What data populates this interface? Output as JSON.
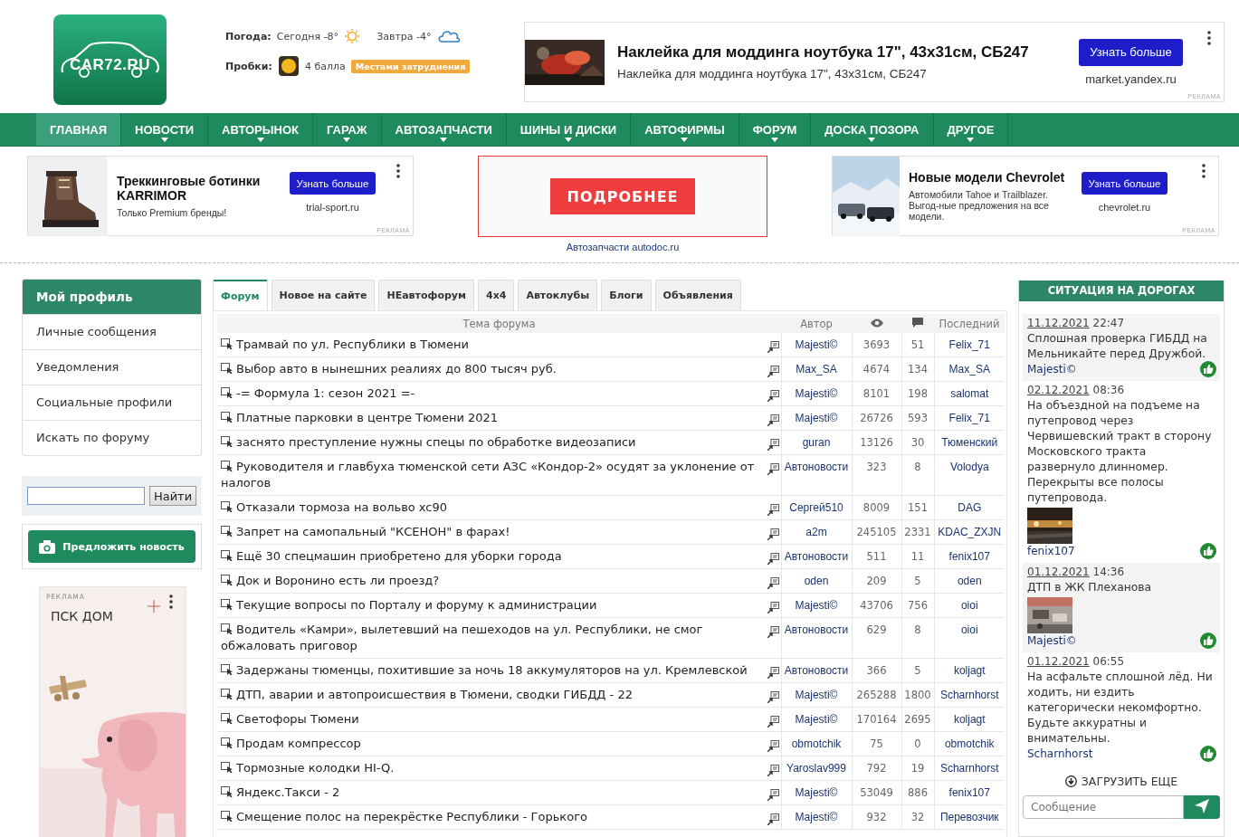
{
  "logo": {
    "text": "CAR72.RU"
  },
  "weather": {
    "label": "Погода:",
    "today": "Сегодня -8°",
    "tomorrow": "Завтра -4°"
  },
  "traffic": {
    "label": "Пробки:",
    "score": "4 балла",
    "status": "Местами затруднения"
  },
  "header_ad": {
    "title": "Наклейка для моддинга ноутбука 17\", 43x31см, СБ247",
    "text": "Наклейка для моддинга ноутбука 17\", 43x31см, СБ247",
    "button": "Узнать больше",
    "domain": "market.yandex.ru",
    "label": "РЕКЛАМА"
  },
  "nav": [
    {
      "label": "ГЛАВНАЯ",
      "selected": true,
      "has_menu": false
    },
    {
      "label": "НОВОСТИ",
      "selected": false,
      "has_menu": true
    },
    {
      "label": "АВТОРЫНОК",
      "selected": false,
      "has_menu": true
    },
    {
      "label": "ГАРАЖ",
      "selected": false,
      "has_menu": true
    },
    {
      "label": "АВТОЗАПЧАСТИ",
      "selected": false,
      "has_menu": true
    },
    {
      "label": "ШИНЫ И ДИСКИ",
      "selected": false,
      "has_menu": true
    },
    {
      "label": "АВТОФИРМЫ",
      "selected": false,
      "has_menu": true
    },
    {
      "label": "ФОРУМ",
      "selected": false,
      "has_menu": true
    },
    {
      "label": "ДОСКА ПОЗОРА",
      "selected": false,
      "has_menu": true
    },
    {
      "label": "ДРУГОЕ",
      "selected": false,
      "has_menu": true
    }
  ],
  "ads": [
    {
      "kind": "product",
      "title": "Треккинговые ботинки KARRIMOR",
      "text": "Только Premium бренды!",
      "button": "Узнать больше",
      "domain": "trial-sport.ru",
      "label": "РЕКЛАМА"
    },
    {
      "kind": "banner",
      "button": "ПОДРОБНЕЕ",
      "caption": "Автозапчасти autodoc.ru"
    },
    {
      "kind": "product",
      "title": "Новые модели Chevrolet",
      "text": "Автомобили Tahoe и Trailblazer. Выгод-ные предложения на все модели.",
      "button": "Узнать больше",
      "domain": "chevrolet.ru",
      "label": "РЕКЛАМА"
    }
  ],
  "profile": {
    "title": "Мой профиль",
    "items": [
      "Личные сообщения",
      "Уведомления",
      "Социальные профили",
      "Искать по форуму"
    ]
  },
  "search": {
    "button": "Найти"
  },
  "suggest_button": "Предложить новость",
  "side_ad": {
    "label": "РЕКЛАМА",
    "brand": "ПСК ДОМ"
  },
  "tabs": [
    {
      "label": "Форум",
      "selected": true
    },
    {
      "label": "Новое на сайте",
      "selected": false
    },
    {
      "label": "НЕавтофорум",
      "selected": false
    },
    {
      "label": "4x4",
      "selected": false
    },
    {
      "label": "Автоклубы",
      "selected": false
    },
    {
      "label": "Блоги",
      "selected": false
    },
    {
      "label": "Объявления",
      "selected": false
    }
  ],
  "forum": {
    "columns": [
      {
        "kind": "text",
        "label": "Тема форума"
      },
      {
        "kind": "text",
        "label": "Автор"
      },
      {
        "kind": "views"
      },
      {
        "kind": "replies"
      },
      {
        "kind": "text",
        "label": "Последний"
      }
    ],
    "rows": [
      {
        "title": "Трамвай по ул. Республики в Тюмени",
        "author": "Majesti©",
        "views": "3693",
        "replies": "51",
        "last": "Felix_71"
      },
      {
        "title": "Выбор авто в нынешних реалиях до 800 тысяч руб.",
        "author": "Max_SA",
        "views": "4674",
        "replies": "134",
        "last": "Max_SA"
      },
      {
        "title": "-= Формула 1: сезон 2021 =-",
        "author": "Majesti©",
        "views": "8101",
        "replies": "198",
        "last": "salomat"
      },
      {
        "title": "Платные парковки в центре Тюмени 2021",
        "author": "Majesti©",
        "views": "26726",
        "replies": "593",
        "last": "Felix_71"
      },
      {
        "title": "заснято преступление нужны спецы по обработке видеозаписи",
        "author": "guran",
        "views": "13126",
        "replies": "30",
        "last": "Тюменский"
      },
      {
        "title": "Руководителя и главбуха тюменской сети АЗС «Кондор-2» осудят за уклонение от налогов",
        "author": "Автоновости",
        "views": "323",
        "replies": "8",
        "last": "Volodya"
      },
      {
        "title": "Отказали тормоза на вольво xc90",
        "author": "Сергей510",
        "views": "8009",
        "replies": "151",
        "last": "DAG"
      },
      {
        "title": "Запрет на самопальный \"КСЕНОН\" в фарах!",
        "author": "a2m",
        "views": "245105",
        "replies": "2331",
        "last": "KDAC_ZXJN"
      },
      {
        "title": "Ещё 30 спецмашин приобретено для уборки города",
        "author": "Автоновости",
        "views": "511",
        "replies": "11",
        "last": "fenix107"
      },
      {
        "title": "Док и Воронино есть ли проезд?",
        "author": "oden",
        "views": "209",
        "replies": "5",
        "last": "oden"
      },
      {
        "title": "Текущие вопросы по Порталу и форуму к администрации",
        "author": "Majesti©",
        "views": "43706",
        "replies": "756",
        "last": "oioi"
      },
      {
        "title": "Водитель «Камри», вылетевший на пешеходов на ул. Республики, не смог обжаловать приговор",
        "author": "Автоновости",
        "views": "629",
        "replies": "8",
        "last": "oioi"
      },
      {
        "title": "Задержаны тюменцы, похитившие за ночь 18 аккумуляторов на ул. Кремлевской",
        "author": "Автоновости",
        "views": "366",
        "replies": "5",
        "last": "koljagt"
      },
      {
        "title": "ДТП, аварии и автопроисшествия в Тюмени, сводки ГИБДД - 22",
        "author": "Majesti©",
        "views": "265288",
        "replies": "1800",
        "last": "Scharnhorst"
      },
      {
        "title": "Светофоры Тюмени",
        "author": "Majesti©",
        "views": "170164",
        "replies": "2695",
        "last": "koljagt"
      },
      {
        "title": "Продам компрессор",
        "author": "obmotchik",
        "views": "75",
        "replies": "0",
        "last": "obmotchik"
      },
      {
        "title": "Тормозные колодки HI-Q.",
        "author": "Yaroslav999",
        "views": "792",
        "replies": "19",
        "last": "Scharnhorst"
      },
      {
        "title": "Яндекс.Такси - 2",
        "author": "Majesti©",
        "views": "53049",
        "replies": "886",
        "last": "fenix107"
      },
      {
        "title": "Смещение полос на перекрёстке Республики - Горького",
        "author": "Majesti©",
        "views": "932",
        "replies": "32",
        "last": "Перевозчик"
      }
    ]
  },
  "road": {
    "title": "СИТУАЦИЯ НА ДОРОГАХ",
    "items": [
      {
        "date": "11.12.2021",
        "time": "22:47",
        "text": "Сплошная проверка ГИБДД на Мельникайте перед Дружбой.",
        "author": "Majesti©",
        "photo": false
      },
      {
        "date": "02.12.2021",
        "time": "08:36",
        "text": "На объездной на подъеме на путепровод через Червишевский тракт в сторону Московского тракта развернуло длинномер. Перекрыты все полосы путепровода.",
        "author": "fenix107",
        "photo": true
      },
      {
        "date": "01.12.2021",
        "time": "14:36",
        "text": "ДТП в ЖК Плеханова",
        "author": "Majesti©",
        "photo": true
      },
      {
        "date": "01.12.2021",
        "time": "06:55",
        "text": "На асфальте сплошной лёд. Ни ходить, ни ездить категорически некомфортно. Будьте аккуратны и внимательны.",
        "author": "Scharnhorst",
        "photo": false
      }
    ],
    "load_more": "ЗАГРУЗИТЬ ЕЩЕ",
    "message_placeholder": "Сообщение"
  }
}
